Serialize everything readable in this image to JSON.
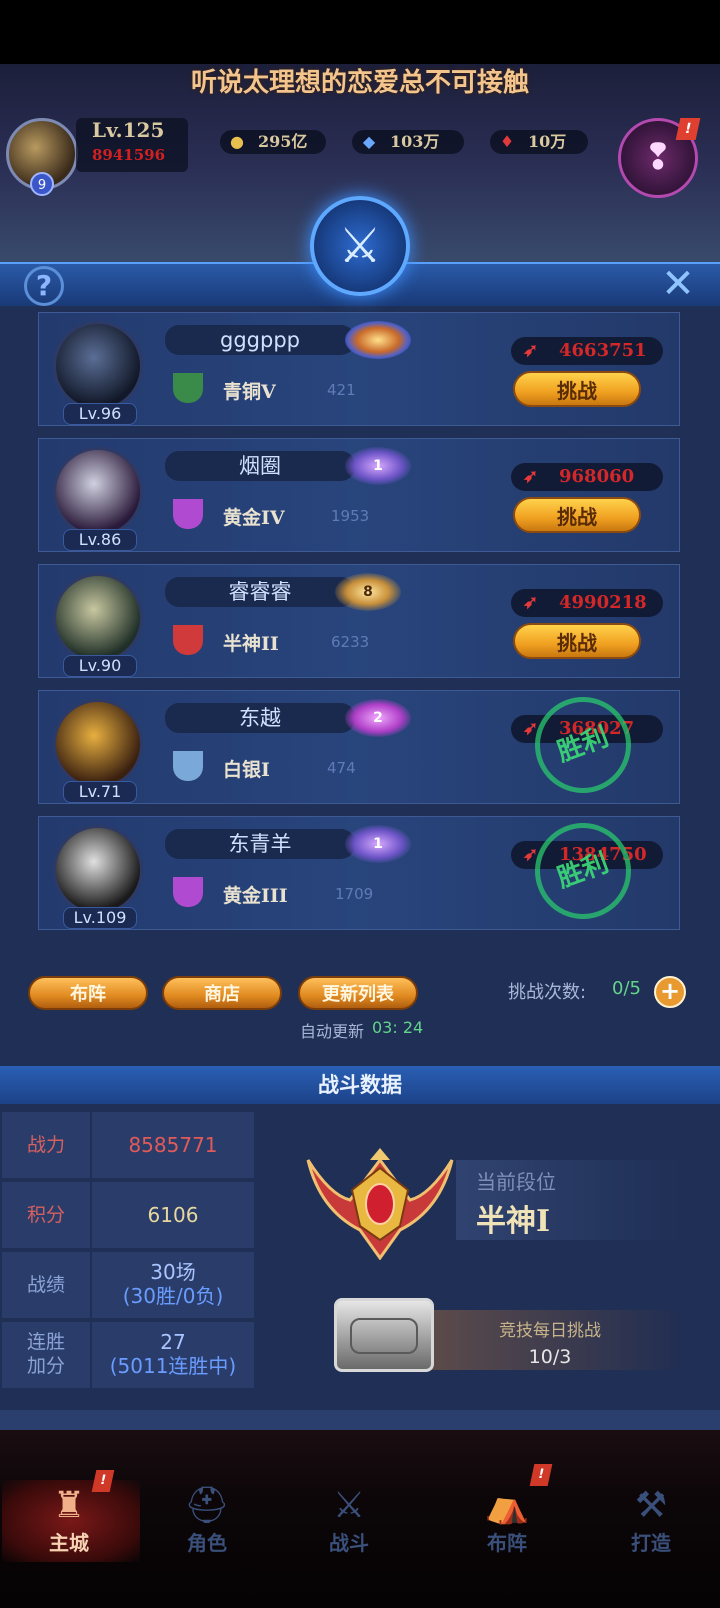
{
  "title": "听说太理想的恋爱总不可接触",
  "player": {
    "level": "Lv.125",
    "power": "8941596",
    "vip": "9"
  },
  "resources": [
    {
      "icon": "gold-coin-icon",
      "value": "295亿"
    },
    {
      "icon": "diamond-icon",
      "value": "103万"
    },
    {
      "icon": "red-crystal-icon",
      "value": "10万"
    }
  ],
  "quest_alert": "!",
  "opponents": [
    {
      "name": "gggppp",
      "level": "Lv.96",
      "rank": "青铜V",
      "points": "421",
      "power": "4663751",
      "action": "挑战",
      "badge": "",
      "result": ""
    },
    {
      "name": "烟圈",
      "level": "Lv.86",
      "rank": "黄金IV",
      "points": "1953",
      "power": "968060",
      "action": "挑战",
      "badge": "1",
      "result": ""
    },
    {
      "name": "睿睿睿",
      "level": "Lv.90",
      "rank": "半神II",
      "points": "6233",
      "power": "4990218",
      "action": "挑战",
      "badge": "8",
      "result": ""
    },
    {
      "name": "东越",
      "level": "Lv.71",
      "rank": "白银I",
      "points": "474",
      "power": "368027",
      "action": "",
      "badge": "2",
      "result": "胜利"
    },
    {
      "name": "东青羊",
      "level": "Lv.109",
      "rank": "黄金III",
      "points": "1709",
      "power": "1384750",
      "action": "",
      "badge": "1",
      "result": "胜利"
    }
  ],
  "actions": {
    "lineup": "布阵",
    "shop": "商店",
    "refresh": "更新列表"
  },
  "attempts": {
    "label": "挑战次数:",
    "value": "0/5"
  },
  "auto_refresh": {
    "label": "自动更新",
    "value": "03: 24"
  },
  "battle_data": {
    "header": "战斗数据",
    "stats": [
      {
        "label": "战力",
        "value": "8585771",
        "sub": ""
      },
      {
        "label": "积分",
        "value": "6106",
        "sub": ""
      },
      {
        "label": "战绩",
        "value": "30场",
        "sub": "(30胜/0负)"
      },
      {
        "label": "连胜\n加分",
        "value": "27",
        "sub": "(5011连胜中)"
      }
    ],
    "current_rank_caption": "当前段位",
    "current_rank": "半神I",
    "daily_caption": "竞技每日挑战",
    "daily_value": "10/3"
  },
  "nav": [
    {
      "label": "主城",
      "icon": "castle-icon",
      "active": true,
      "alert": "!"
    },
    {
      "label": "角色",
      "icon": "helmet-icon",
      "active": false,
      "alert": ""
    },
    {
      "label": "战斗",
      "icon": "crossed-swords-icon",
      "active": false,
      "alert": ""
    },
    {
      "label": "布阵",
      "icon": "formation-icon",
      "active": false,
      "alert": "!"
    },
    {
      "label": "打造",
      "icon": "anvil-icon",
      "active": false,
      "alert": ""
    }
  ],
  "colors": {
    "power_red": "#d42828",
    "win_green": "#2ac86e",
    "gold_button": "#f0a020",
    "panel_blue": "#1f2f55"
  }
}
